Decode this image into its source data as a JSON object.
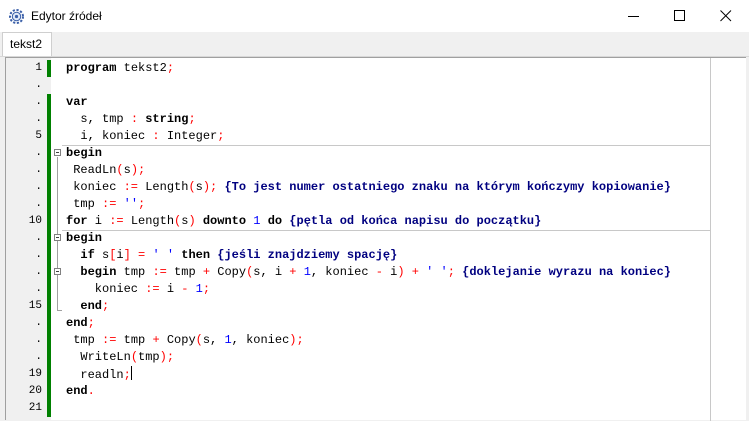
{
  "window": {
    "title": "Edytor źródeł",
    "controls": [
      "minimize",
      "maximize",
      "close"
    ]
  },
  "tabs": [
    {
      "label": "tekst2",
      "active": true
    }
  ],
  "editor": {
    "lines": [
      {
        "n": "1",
        "tokens": [
          [
            "kw",
            "program"
          ],
          [
            "t",
            " tekst2"
          ],
          [
            "sym",
            ";"
          ]
        ]
      },
      {
        "n": ".",
        "tokens": []
      },
      {
        "n": ".",
        "tokens": [
          [
            "kw",
            "var"
          ]
        ]
      },
      {
        "n": ".",
        "tokens": [
          [
            "t",
            "  s, tmp "
          ],
          [
            "sym",
            ":"
          ],
          [
            "t",
            " "
          ],
          [
            "kw",
            "string"
          ],
          [
            "sym",
            ";"
          ]
        ]
      },
      {
        "n": "5",
        "tokens": [
          [
            "t",
            "  i, koniec "
          ],
          [
            "sym",
            ":"
          ],
          [
            "t",
            " Integer"
          ],
          [
            "sym",
            ";"
          ]
        ]
      },
      {
        "n": ".",
        "tokens": [
          [
            "kw",
            "begin"
          ]
        ]
      },
      {
        "n": ".",
        "tokens": [
          [
            "t",
            " ReadLn"
          ],
          [
            "sym",
            "("
          ],
          [
            "t",
            "s"
          ],
          [
            "sym",
            ")"
          ],
          [
            "sym",
            ";"
          ]
        ]
      },
      {
        "n": ".",
        "tokens": [
          [
            "t",
            " koniec "
          ],
          [
            "sym",
            ":="
          ],
          [
            "t",
            " Length"
          ],
          [
            "sym",
            "("
          ],
          [
            "t",
            "s"
          ],
          [
            "sym",
            ")"
          ],
          [
            "sym",
            ";"
          ],
          [
            "t",
            " "
          ],
          [
            "cmt",
            "{To jest numer ostatniego znaku na którym kończymy kopiowanie}"
          ]
        ]
      },
      {
        "n": ".",
        "tokens": [
          [
            "t",
            " tmp "
          ],
          [
            "sym",
            ":="
          ],
          [
            "t",
            " "
          ],
          [
            "str",
            "''"
          ],
          [
            "sym",
            ";"
          ]
        ]
      },
      {
        "n": "10",
        "tokens": [
          [
            "kw",
            "for"
          ],
          [
            "t",
            " i "
          ],
          [
            "sym",
            ":="
          ],
          [
            "t",
            " Length"
          ],
          [
            "sym",
            "("
          ],
          [
            "t",
            "s"
          ],
          [
            "sym",
            ")"
          ],
          [
            "t",
            " "
          ],
          [
            "kw",
            "downto"
          ],
          [
            "t",
            " "
          ],
          [
            "num",
            "1"
          ],
          [
            "t",
            " "
          ],
          [
            "kw",
            "do"
          ],
          [
            "t",
            " "
          ],
          [
            "cmt",
            "{pętla od końca napisu do początku}"
          ]
        ]
      },
      {
        "n": ".",
        "tokens": [
          [
            "kw",
            "begin"
          ]
        ]
      },
      {
        "n": ".",
        "tokens": [
          [
            "t",
            "  "
          ],
          [
            "kw",
            "if"
          ],
          [
            "t",
            " s"
          ],
          [
            "sym",
            "["
          ],
          [
            "t",
            "i"
          ],
          [
            "sym",
            "]"
          ],
          [
            "t",
            " "
          ],
          [
            "sym",
            "="
          ],
          [
            "t",
            " "
          ],
          [
            "str",
            "' '"
          ],
          [
            "t",
            " "
          ],
          [
            "kw",
            "then"
          ],
          [
            "t",
            " "
          ],
          [
            "cmt",
            "{jeśli znajdziemy spację}"
          ]
        ]
      },
      {
        "n": ".",
        "tokens": [
          [
            "t",
            "  "
          ],
          [
            "kw",
            "begin"
          ],
          [
            "t",
            " tmp "
          ],
          [
            "sym",
            ":="
          ],
          [
            "t",
            " tmp "
          ],
          [
            "sym",
            "+"
          ],
          [
            "t",
            " Copy"
          ],
          [
            "sym",
            "("
          ],
          [
            "t",
            "s, i "
          ],
          [
            "sym",
            "+"
          ],
          [
            "t",
            " "
          ],
          [
            "num",
            "1"
          ],
          [
            "t",
            ", koniec "
          ],
          [
            "sym",
            "-"
          ],
          [
            "t",
            " i"
          ],
          [
            "sym",
            ")"
          ],
          [
            "t",
            " "
          ],
          [
            "sym",
            "+"
          ],
          [
            "t",
            " "
          ],
          [
            "str",
            "' '"
          ],
          [
            "sym",
            ";"
          ],
          [
            "t",
            " "
          ],
          [
            "cmt",
            "{doklejanie wyrazu na koniec}"
          ]
        ]
      },
      {
        "n": ".",
        "tokens": [
          [
            "t",
            "    koniec "
          ],
          [
            "sym",
            ":="
          ],
          [
            "t",
            " i "
          ],
          [
            "sym",
            "-"
          ],
          [
            "t",
            " "
          ],
          [
            "num",
            "1"
          ],
          [
            "sym",
            ";"
          ]
        ]
      },
      {
        "n": "15",
        "tokens": [
          [
            "t",
            "  "
          ],
          [
            "kw",
            "end"
          ],
          [
            "sym",
            ";"
          ]
        ]
      },
      {
        "n": ".",
        "tokens": [
          [
            "kw",
            "end"
          ],
          [
            "sym",
            ";"
          ]
        ]
      },
      {
        "n": ".",
        "tokens": [
          [
            "t",
            " tmp "
          ],
          [
            "sym",
            ":="
          ],
          [
            "t",
            " tmp "
          ],
          [
            "sym",
            "+"
          ],
          [
            "t",
            " Copy"
          ],
          [
            "sym",
            "("
          ],
          [
            "t",
            "s, "
          ],
          [
            "num",
            "1"
          ],
          [
            "t",
            ", koniec"
          ],
          [
            "sym",
            ")"
          ],
          [
            "sym",
            ";"
          ]
        ]
      },
      {
        "n": ".",
        "tokens": [
          [
            "t",
            "  WriteLn"
          ],
          [
            "sym",
            "("
          ],
          [
            "t",
            "tmp"
          ],
          [
            "sym",
            ")"
          ],
          [
            "sym",
            ";"
          ]
        ]
      },
      {
        "n": "19",
        "tokens": [
          [
            "t",
            "  readln"
          ],
          [
            "sym",
            ";"
          ]
        ],
        "caret": true
      },
      {
        "n": "20",
        "tokens": [
          [
            "kw",
            "end"
          ],
          [
            "sym",
            "."
          ]
        ]
      },
      {
        "n": "21",
        "tokens": []
      }
    ]
  }
}
